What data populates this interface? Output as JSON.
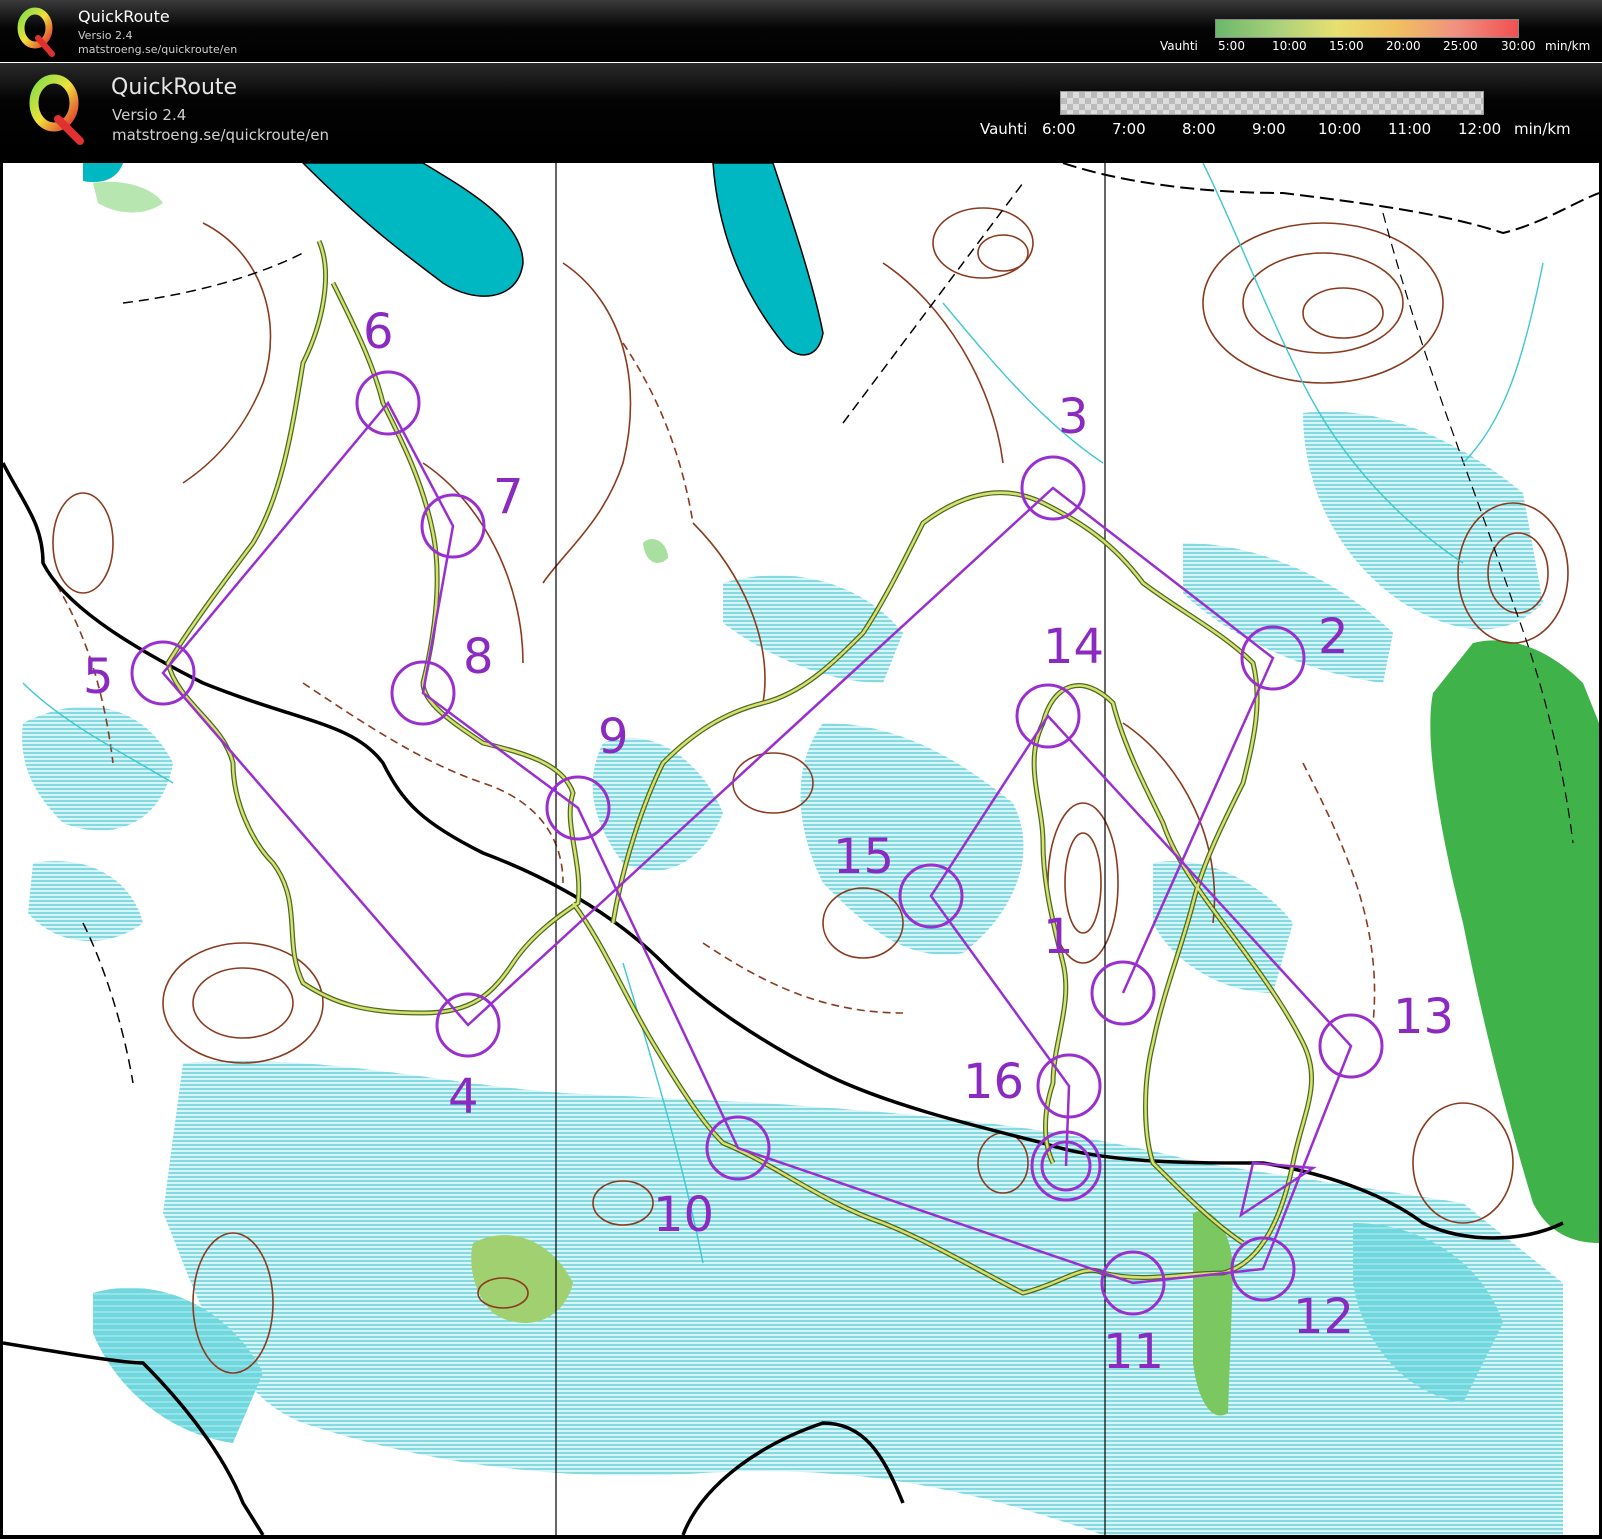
{
  "header_small": {
    "app_name": "QuickRoute",
    "version": "Versio 2.4",
    "url": "matstroeng.se/quickroute/en",
    "pace_label": "Vauhti",
    "ticks": [
      "5:00",
      "10:00",
      "15:00",
      "20:00",
      "25:00",
      "30:00"
    ],
    "unit": "min/km"
  },
  "header_large": {
    "app_name": "QuickRoute",
    "version": "Versio 2.4",
    "url": "matstroeng.se/quickroute/en",
    "pace_label": "Vauhti",
    "ticks": [
      "6:00",
      "7:00",
      "8:00",
      "9:00",
      "10:00",
      "11:00",
      "12:00"
    ],
    "unit": "min/km"
  },
  "colors": {
    "course": "#9a2fd0",
    "route": "#c8d860",
    "contour": "#8a3a1e",
    "marsh": "#5fd0d8",
    "water": "#00b5bf",
    "vegetation": "#3fb24a"
  },
  "controls": [
    {
      "label": "1"
    },
    {
      "label": "2"
    },
    {
      "label": "3"
    },
    {
      "label": "4"
    },
    {
      "label": "5"
    },
    {
      "label": "6"
    },
    {
      "label": "7"
    },
    {
      "label": "8"
    },
    {
      "label": "9"
    },
    {
      "label": "10"
    },
    {
      "label": "11"
    },
    {
      "label": "12"
    },
    {
      "label": "13"
    },
    {
      "label": "14"
    },
    {
      "label": "15"
    },
    {
      "label": "16"
    }
  ]
}
